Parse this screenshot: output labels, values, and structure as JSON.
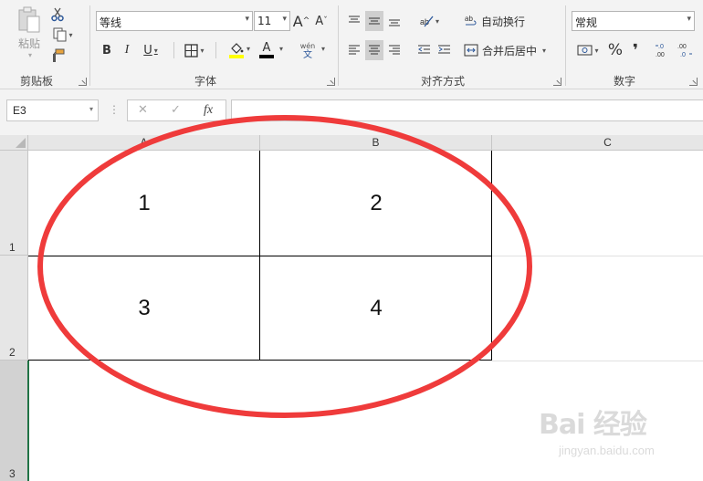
{
  "ribbon": {
    "clipboard": {
      "paste_label": "粘贴",
      "group_label": "剪贴板"
    },
    "font": {
      "font_name": "等线",
      "font_size": "11",
      "grow_label": "A",
      "shrink_label": "A",
      "bold_label": "B",
      "italic_label": "I",
      "underline_label": "U",
      "font_color_label": "A",
      "phonetic_top": "wén",
      "phonetic_bottom": "文",
      "group_label": "字体",
      "fill_color": "#ffff00",
      "font_color": "#000000"
    },
    "alignment": {
      "wrap_label": "自动换行",
      "merge_label": "合并后居中",
      "group_label": "对齐方式"
    },
    "number": {
      "format": "常规",
      "percent_label": "%",
      "comma_label": "❜",
      "group_label": "数字"
    }
  },
  "formula_bar": {
    "name_box": "E3",
    "fx_label": "fx",
    "cancel_label": "✕",
    "enter_label": "✓",
    "more_label": "⋮"
  },
  "sheet": {
    "columns": [
      "A",
      "B",
      "C"
    ],
    "rows": [
      "1",
      "2",
      "3"
    ],
    "cells": {
      "A1": "1",
      "B1": "2",
      "A2": "3",
      "B2": "4"
    }
  },
  "annotation": {
    "ellipse_color": "#ef3b3b"
  },
  "watermark": {
    "logo": "Bai 经验",
    "url": "jingyan.baidu.com"
  }
}
